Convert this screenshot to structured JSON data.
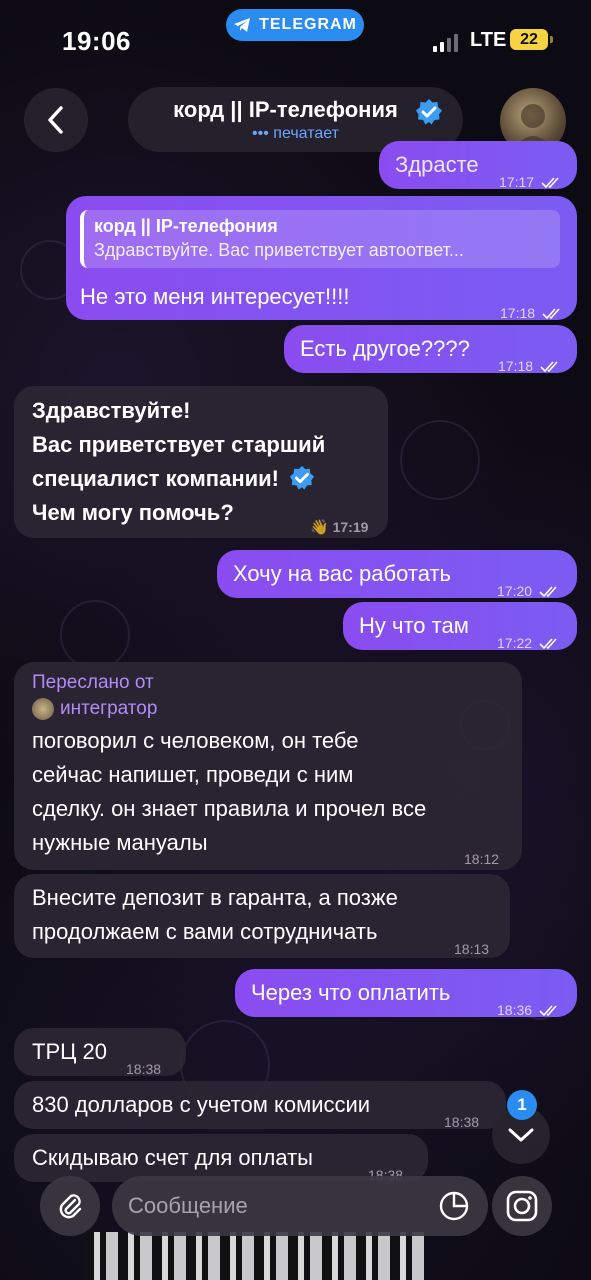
{
  "status_bar": {
    "time": "19:06",
    "app_pill": "TELEGRAM",
    "network": "LTE",
    "battery": "22"
  },
  "header": {
    "title": "корд || IP-телефония",
    "status": "••• печатает"
  },
  "messages": [
    {
      "dir": "out",
      "text": "Здрасте",
      "time": "17:17"
    },
    {
      "dir": "out",
      "reply_name": "корд || IP-телефония",
      "reply_text": "Здравствуйте. Вас приветствует автоответ...",
      "text": "Не это меня интересует!!!!",
      "time": "17:18"
    },
    {
      "dir": "out",
      "text": "Есть другое????",
      "time": "17:18"
    },
    {
      "dir": "in",
      "lines": [
        "Здравствуйте!",
        "Вас приветствует старший",
        "специалист компании!",
        "Чем могу помочь?"
      ],
      "time": "17:19",
      "reaction": "👋"
    },
    {
      "dir": "out",
      "text": "Хочу на вас работать",
      "time": "17:20"
    },
    {
      "dir": "out",
      "text": "Ну что там",
      "time": "17:22"
    },
    {
      "dir": "in",
      "forward_label": "Переслано от",
      "forward_from": "интегратор",
      "lines": [
        "поговорил с человеком, он тебе",
        "сейчас напишет, проведи с ним",
        "сделку. он знает правила и прочел все",
        "нужные мануалы"
      ],
      "time": "18:12"
    },
    {
      "dir": "in",
      "lines": [
        "Внесите депозит в гаранта, а позже",
        "продолжаем с вами сотрудничать"
      ],
      "time": "18:13"
    },
    {
      "dir": "out",
      "text": "Через что оплатить",
      "time": "18:36"
    },
    {
      "dir": "in",
      "text": "ТРЦ 20",
      "time": "18:38"
    },
    {
      "dir": "in",
      "text": "830 долларов с учетом комиссии",
      "time": "18:38"
    },
    {
      "dir": "in",
      "text": "Скидываю счет для оплаты",
      "time": "18:38"
    }
  ],
  "scroll": {
    "unread": "1"
  },
  "composer": {
    "placeholder": "Сообщение"
  },
  "colors": {
    "outgoing": "#8a4cf0",
    "incoming": "#2c2634",
    "accent": "#2a8cf0",
    "battery": "#f5d342"
  }
}
